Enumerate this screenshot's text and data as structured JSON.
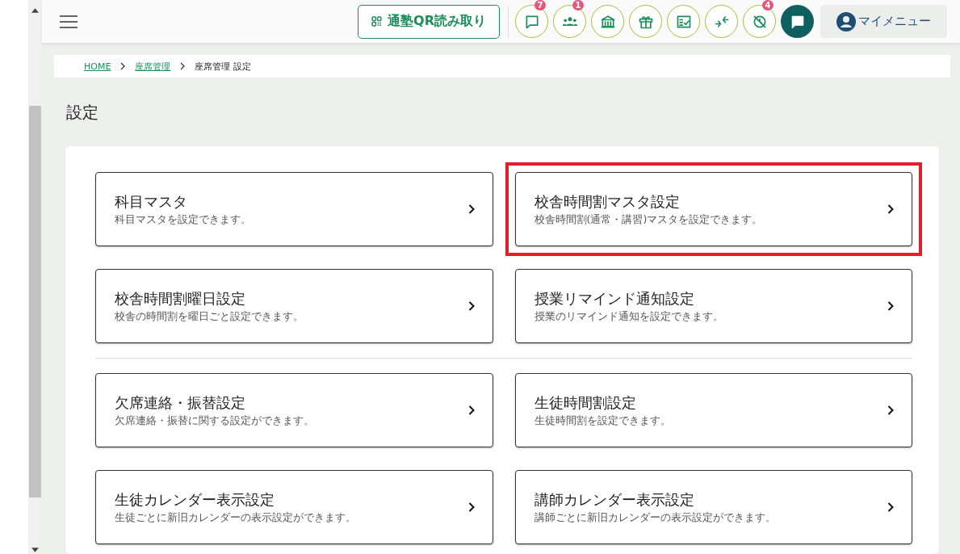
{
  "header": {
    "qr_button": "通塾QR読み取り",
    "icon_buttons": [
      {
        "kind": "chat",
        "badge": "7"
      },
      {
        "kind": "group",
        "badge": "1"
      },
      {
        "kind": "school"
      },
      {
        "kind": "gift"
      },
      {
        "kind": "checklist"
      },
      {
        "kind": "transfer"
      },
      {
        "kind": "no-clock",
        "badge": "4"
      }
    ],
    "my_menu": "マイメニュー"
  },
  "breadcrumb": [
    {
      "label": "HOME",
      "link": true
    },
    {
      "label": "座席管理",
      "link": true
    },
    {
      "label": "座席管理 設定",
      "link": false
    }
  ],
  "page_title": "設定",
  "card_groups": [
    [
      {
        "title": "科目マスタ",
        "description": "科目マスタを設定できます。",
        "highlighted": false
      },
      {
        "title": "校舎時間割マスタ設定",
        "description": "校舎時間割(通常・講習)マスタを設定できます。",
        "highlighted": true
      },
      {
        "title": "校舎時間割曜日設定",
        "description": "校舎の時間割を曜日ごと設定できます。",
        "highlighted": false
      },
      {
        "title": "授業リマインド通知設定",
        "description": "授業のリマインド通知を設定できます。",
        "highlighted": false
      }
    ],
    [
      {
        "title": "欠席連絡・振替設定",
        "description": "欠席連絡・振替に関する設定ができます。",
        "highlighted": false
      },
      {
        "title": "生徒時間割設定",
        "description": "生徒時間割を設定できます。",
        "highlighted": false
      },
      {
        "title": "生徒カレンダー表示設定",
        "description": "生徒ごとに新旧カレンダーの表示設定ができます。",
        "highlighted": false
      },
      {
        "title": "講師カレンダー表示設定",
        "description": "講師ごとに新旧カレンダーの表示設定ができます。",
        "highlighted": false
      }
    ]
  ]
}
